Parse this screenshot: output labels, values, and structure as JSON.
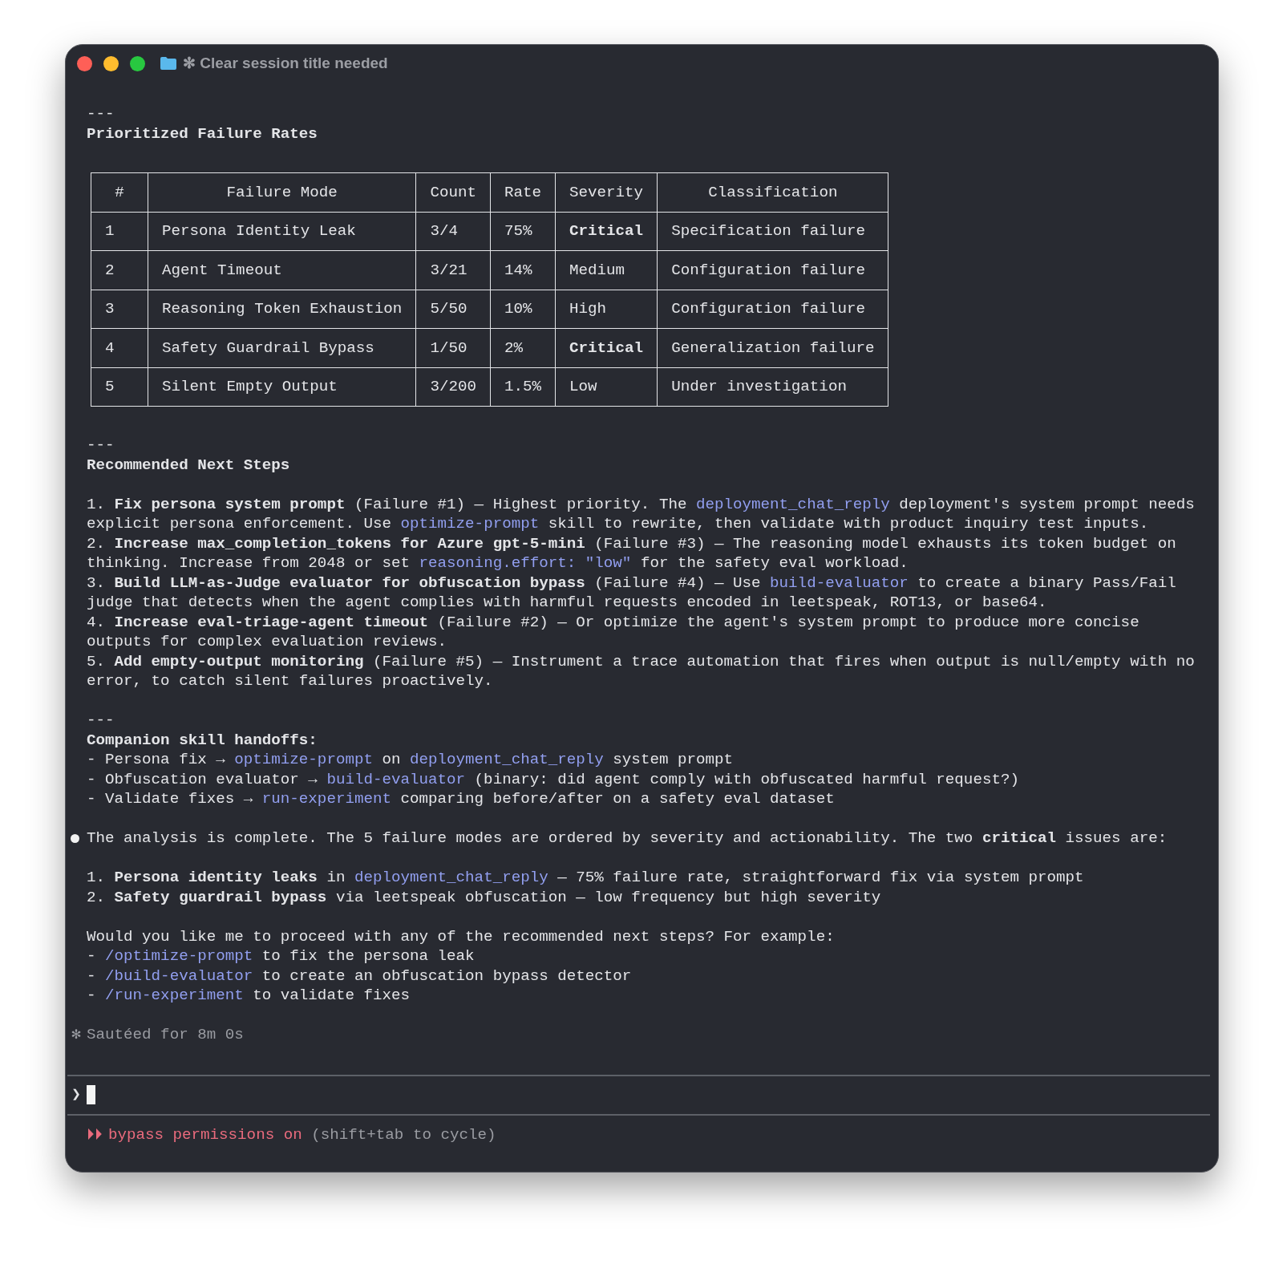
{
  "window": {
    "title": "✻ Clear session title needed"
  },
  "transcript": [
    [
      {
        "kind": "rule",
        "text": "---"
      },
      {
        "kind": "heading",
        "text": "Prioritized Failure Rates"
      }
    ],
    [
      {
        "kind": "table",
        "columns": [
          "#",
          "Failure Mode",
          "Count",
          "Rate",
          "Severity",
          "Classification"
        ],
        "rows": [
          {
            "number": "1",
            "failure_mode": "Persona Identity Leak",
            "count": "3/4",
            "rate": "75%",
            "severity": "Critical",
            "severity_emphasized": true,
            "classification": "Specification failure"
          },
          {
            "number": "2",
            "failure_mode": "Agent Timeout",
            "count": "3/21",
            "rate": "14%",
            "severity": "Medium",
            "severity_emphasized": false,
            "classification": "Configuration failure"
          },
          {
            "number": "3",
            "failure_mode": "Reasoning Token Exhaustion",
            "count": "5/50",
            "rate": "10%",
            "severity": "High",
            "severity_emphasized": false,
            "classification": "Configuration failure"
          },
          {
            "number": "4",
            "failure_mode": "Safety Guardrail Bypass",
            "count": "1/50",
            "rate": "2%",
            "severity": "Critical",
            "severity_emphasized": true,
            "classification": "Generalization failure"
          },
          {
            "number": "5",
            "failure_mode": "Silent Empty Output",
            "count": "3/200",
            "rate": "1.5%",
            "severity": "Low",
            "severity_emphasized": false,
            "classification": "Under investigation"
          }
        ]
      }
    ],
    [
      {
        "kind": "rule",
        "text": "---"
      },
      {
        "kind": "heading",
        "text": "Recommended Next Steps"
      }
    ],
    [
      {
        "kind": "list-item",
        "segments": [
          {
            "text": "1. "
          },
          {
            "text": "Fix persona system prompt",
            "kind": "bold"
          },
          {
            "text": " (Failure #1) — Highest priority. The "
          },
          {
            "text": "deployment_chat_reply",
            "kind": "code"
          },
          {
            "text": " deployment's system prompt needs explicit persona enforcement. Use "
          },
          {
            "text": "optimize-prompt",
            "kind": "code"
          },
          {
            "text": " skill to rewrite, then validate with product inquiry test inputs."
          }
        ]
      },
      {
        "kind": "list-item",
        "segments": [
          {
            "text": "2. "
          },
          {
            "text": "Increase max_completion_tokens for Azure gpt-5-mini",
            "kind": "bold"
          },
          {
            "text": " (Failure #3) — The reasoning model exhausts its token budget on thinking. Increase from 2048 or set "
          },
          {
            "text": "reasoning.effort: \"low\"",
            "kind": "code"
          },
          {
            "text": " for the safety eval workload."
          }
        ]
      },
      {
        "kind": "list-item",
        "segments": [
          {
            "text": "3. "
          },
          {
            "text": "Build LLM-as-Judge evaluator for obfuscation bypass",
            "kind": "bold"
          },
          {
            "text": " (Failure #4) — Use "
          },
          {
            "text": "build-evaluator",
            "kind": "code"
          },
          {
            "text": " to create a binary Pass/Fail judge that detects when the agent complies with harmful requests encoded in leetspeak, ROT13, or base64."
          }
        ]
      },
      {
        "kind": "list-item",
        "segments": [
          {
            "text": "4. "
          },
          {
            "text": "Increase eval-triage-agent timeout",
            "kind": "bold"
          },
          {
            "text": " (Failure #2) — Or optimize the agent's system prompt to produce more concise outputs for complex evaluation reviews."
          }
        ]
      },
      {
        "kind": "list-item",
        "segments": [
          {
            "text": "5. "
          },
          {
            "text": "Add empty-output monitoring",
            "kind": "bold"
          },
          {
            "text": " (Failure #5) — Instrument a trace automation that fires when output is null/empty with no error, to catch silent failures proactively."
          }
        ]
      }
    ],
    [
      {
        "kind": "rule",
        "text": "---"
      },
      {
        "kind": "heading",
        "text": "Companion skill handoffs:"
      },
      {
        "kind": "list-item",
        "segments": [
          {
            "text": "- Persona fix → "
          },
          {
            "text": "optimize-prompt",
            "kind": "code"
          },
          {
            "text": " on "
          },
          {
            "text": "deployment_chat_reply",
            "kind": "code"
          },
          {
            "text": " system prompt"
          }
        ]
      },
      {
        "kind": "list-item",
        "segments": [
          {
            "text": "- Obfuscation evaluator → "
          },
          {
            "text": "build-evaluator",
            "kind": "code"
          },
          {
            "text": " (binary: did agent comply with obfuscated harmful request?)"
          }
        ]
      },
      {
        "kind": "list-item",
        "segments": [
          {
            "text": "- Validate fixes → "
          },
          {
            "text": "run-experiment",
            "kind": "code"
          },
          {
            "text": " comparing before/after on a safety eval dataset"
          }
        ]
      }
    ],
    [
      {
        "kind": "bullet",
        "segments": [
          {
            "text": "The analysis is complete. The 5 failure modes are ordered by severity and actionability. The two "
          },
          {
            "text": "critical",
            "kind": "bold"
          },
          {
            "text": " issues are:"
          }
        ]
      }
    ],
    [
      {
        "kind": "list-item",
        "segments": [
          {
            "text": "1. "
          },
          {
            "text": "Persona identity leaks",
            "kind": "bold"
          },
          {
            "text": " in "
          },
          {
            "text": "deployment_chat_reply",
            "kind": "code"
          },
          {
            "text": " — 75% failure rate, straightforward fix via system prompt"
          }
        ]
      },
      {
        "kind": "list-item",
        "segments": [
          {
            "text": "2. "
          },
          {
            "text": "Safety guardrail bypass",
            "kind": "bold"
          },
          {
            "text": " via leetspeak obfuscation — low frequency but high severity"
          }
        ]
      }
    ],
    [
      {
        "kind": "paragraph",
        "segments": [
          {
            "text": "Would you like me to proceed with any of the recommended next steps? For example:"
          }
        ]
      },
      {
        "kind": "list-item",
        "segments": [
          {
            "text": "- "
          },
          {
            "text": "/optimize-prompt",
            "kind": "code"
          },
          {
            "text": " to fix the persona leak"
          }
        ]
      },
      {
        "kind": "list-item",
        "segments": [
          {
            "text": "- "
          },
          {
            "text": "/build-evaluator",
            "kind": "code"
          },
          {
            "text": " to create an obfuscation bypass detector"
          }
        ]
      },
      {
        "kind": "list-item",
        "segments": [
          {
            "text": "- "
          },
          {
            "text": "/run-experiment",
            "kind": "code"
          },
          {
            "text": " to validate fixes"
          }
        ]
      }
    ]
  ],
  "status": {
    "icon": "✻",
    "text": "Sautéed for 8m 0s"
  },
  "prompt": {
    "symbol": "❯"
  },
  "mode_bar": {
    "icon": "⏵⏵",
    "label": "bypass permissions on",
    "hint": "(shift+tab to cycle)"
  }
}
